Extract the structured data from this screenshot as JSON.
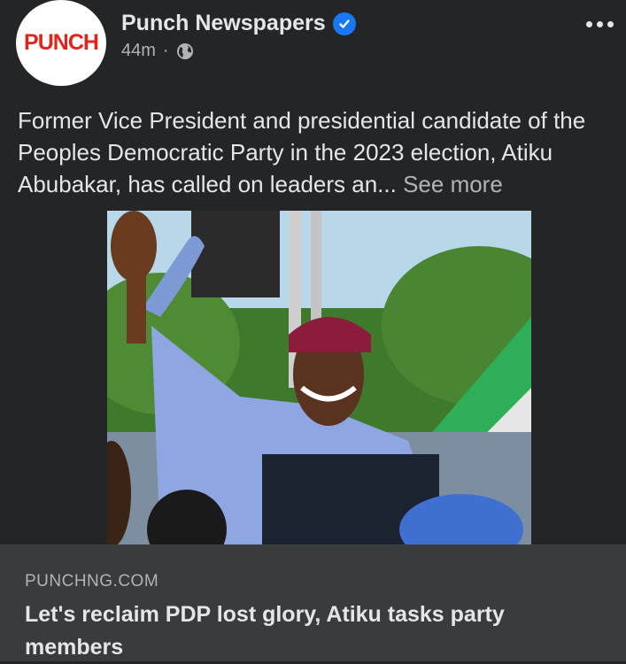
{
  "post": {
    "page_name": "Punch Newspapers",
    "avatar_text": "PUNCH",
    "time": "44m",
    "separator": "·",
    "privacy_icon": "globe-icon",
    "verified_icon": "verified-badge-icon",
    "menu_icon": "more-options-icon",
    "body_text": "Former Vice President and presidential candidate of the Peoples Democratic Party in the 2023 election, Atiku Abubakar, has called on leaders an...",
    "see_more": " See more",
    "photo_alt": "Atiku Abubakar waving",
    "link": {
      "domain": "PUNCHNG.COM",
      "headline": "Let's reclaim PDP lost glory, Atiku tasks party members"
    }
  },
  "colors": {
    "background": "#242526",
    "link_box": "#3a3b3c",
    "text_primary": "#e4e6eb",
    "text_secondary": "#b0b3b8",
    "verified": "#1877f2",
    "logo_red": "#e2231a"
  }
}
